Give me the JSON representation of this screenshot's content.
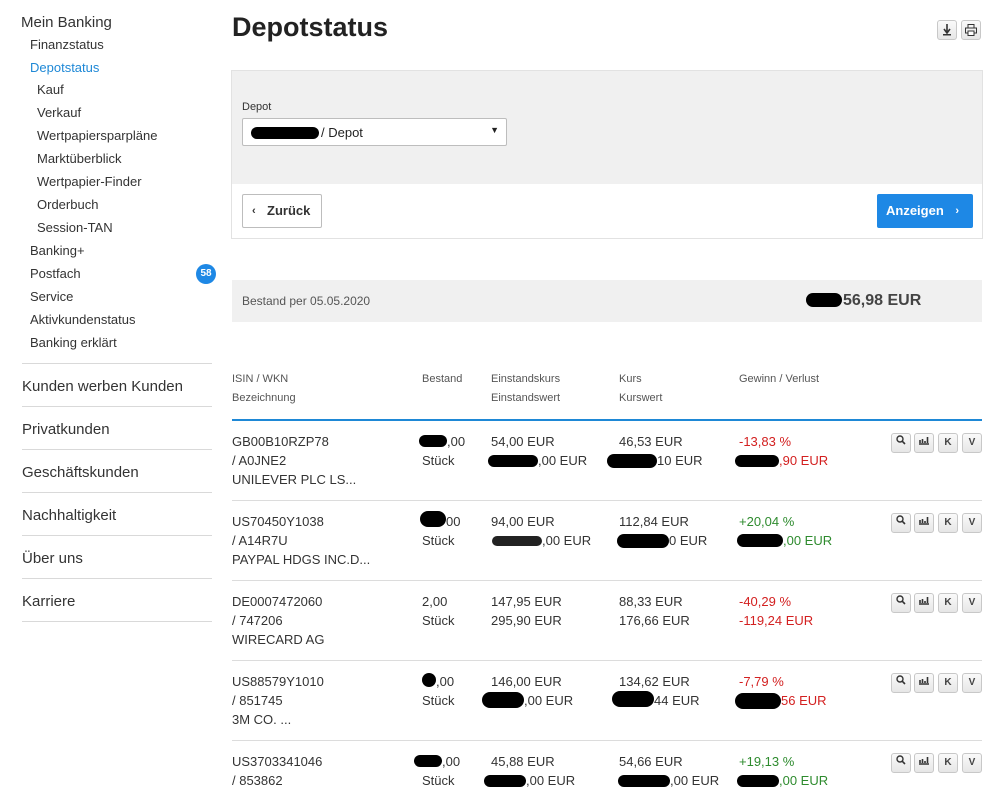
{
  "sidebar": {
    "main_title": "Mein Banking",
    "sub_items": [
      {
        "label": "Finanzstatus"
      },
      {
        "label": "Depotstatus"
      }
    ],
    "depot_items": [
      {
        "label": "Kauf"
      },
      {
        "label": "Verkauf"
      },
      {
        "label": "Wertpapiersparpläne"
      },
      {
        "label": "Marktüberblick"
      },
      {
        "label": "Wertpapier-Finder"
      },
      {
        "label": "Orderbuch"
      },
      {
        "label": "Session-TAN"
      }
    ],
    "more_items": [
      {
        "label": "Banking+"
      },
      {
        "label": "Postfach"
      },
      {
        "label": "Service"
      },
      {
        "label": "Aktivkundenstatus"
      },
      {
        "label": "Banking erklärt"
      }
    ],
    "postfach_badge": "58",
    "sections": [
      {
        "label": "Kunden werben Kunden"
      },
      {
        "label": "Privatkunden"
      },
      {
        "label": "Geschäftskunden"
      },
      {
        "label": "Nachhaltigkeit"
      },
      {
        "label": "Über uns"
      },
      {
        "label": "Karriere"
      }
    ]
  },
  "page": {
    "title": "Depotstatus",
    "download_icon": "download-icon",
    "print_icon": "print-icon"
  },
  "form": {
    "depot_label": "Depot",
    "depot_value": "/ Depot",
    "back_label": "Zurück",
    "show_label": "Anzeigen"
  },
  "balance": {
    "label": "Bestand per 05.05.2020",
    "value": "56,98 EUR"
  },
  "table": {
    "headers": {
      "isin": "ISIN / WKN",
      "name": "Bezeichnung",
      "bestand": "Bestand",
      "einstandskurs": "Einstandskurs",
      "einstandswert": "Einstandswert",
      "kurs": "Kurs",
      "kurswert": "Kurswert",
      "gewinn": "Gewinn / Verlust"
    },
    "action_labels": {
      "k": "K",
      "v": "V"
    },
    "rows": [
      {
        "isin": "GB00B10RZP78",
        "wkn": "/ A0JNE2",
        "name": "UNILEVER PLC LS...",
        "qty": ",00",
        "unit": "Stück",
        "ek": "54,00 EUR",
        "ew": ",00 EUR",
        "kurs": "46,53 EUR",
        "kw": "10 EUR",
        "gv_pct": "-13,83 %",
        "gv_abs": ",90 EUR"
      },
      {
        "isin": "US70450Y1038",
        "wkn": "/ A14R7U",
        "name": "PAYPAL HDGS INC.D...",
        "qty": "00",
        "unit": "Stück",
        "ek": "94,00 EUR",
        "ew": ",00 EUR",
        "kurs": "112,84 EUR",
        "kw": "0 EUR",
        "gv_pct": "+20,04 %",
        "gv_abs": ",00 EUR"
      },
      {
        "isin": "DE0007472060",
        "wkn": "/ 747206",
        "name": "WIRECARD AG",
        "qty": "2,00",
        "unit": "Stück",
        "ek": "147,95 EUR",
        "ew": "295,90 EUR",
        "kurs": "88,33 EUR",
        "kw": "176,66 EUR",
        "gv_pct": "-40,29 %",
        "gv_abs": "-119,24 EUR"
      },
      {
        "isin": "US88579Y1010",
        "wkn": "/ 851745",
        "name": "3M CO. ...",
        "qty": ",00",
        "unit": "Stück",
        "ek": "146,00 EUR",
        "ew": ",00 EUR",
        "kurs": "134,62 EUR",
        "kw": "44 EUR",
        "gv_pct": "-7,79 %",
        "gv_abs": "56 EUR"
      },
      {
        "isin": "US3703341046",
        "wkn": "/ 853862",
        "name": "",
        "qty": ",00",
        "unit": "Stück",
        "ek": "45,88 EUR",
        "ew": ",00 EUR",
        "kurs": "54,66 EUR",
        "kw": ",00 EUR",
        "gv_pct": "+19,13 %",
        "gv_abs": ",00 EUR"
      }
    ]
  },
  "colors": {
    "accent": "#1e88e5",
    "positive": "#2e8b2e",
    "negative": "#d32020"
  }
}
